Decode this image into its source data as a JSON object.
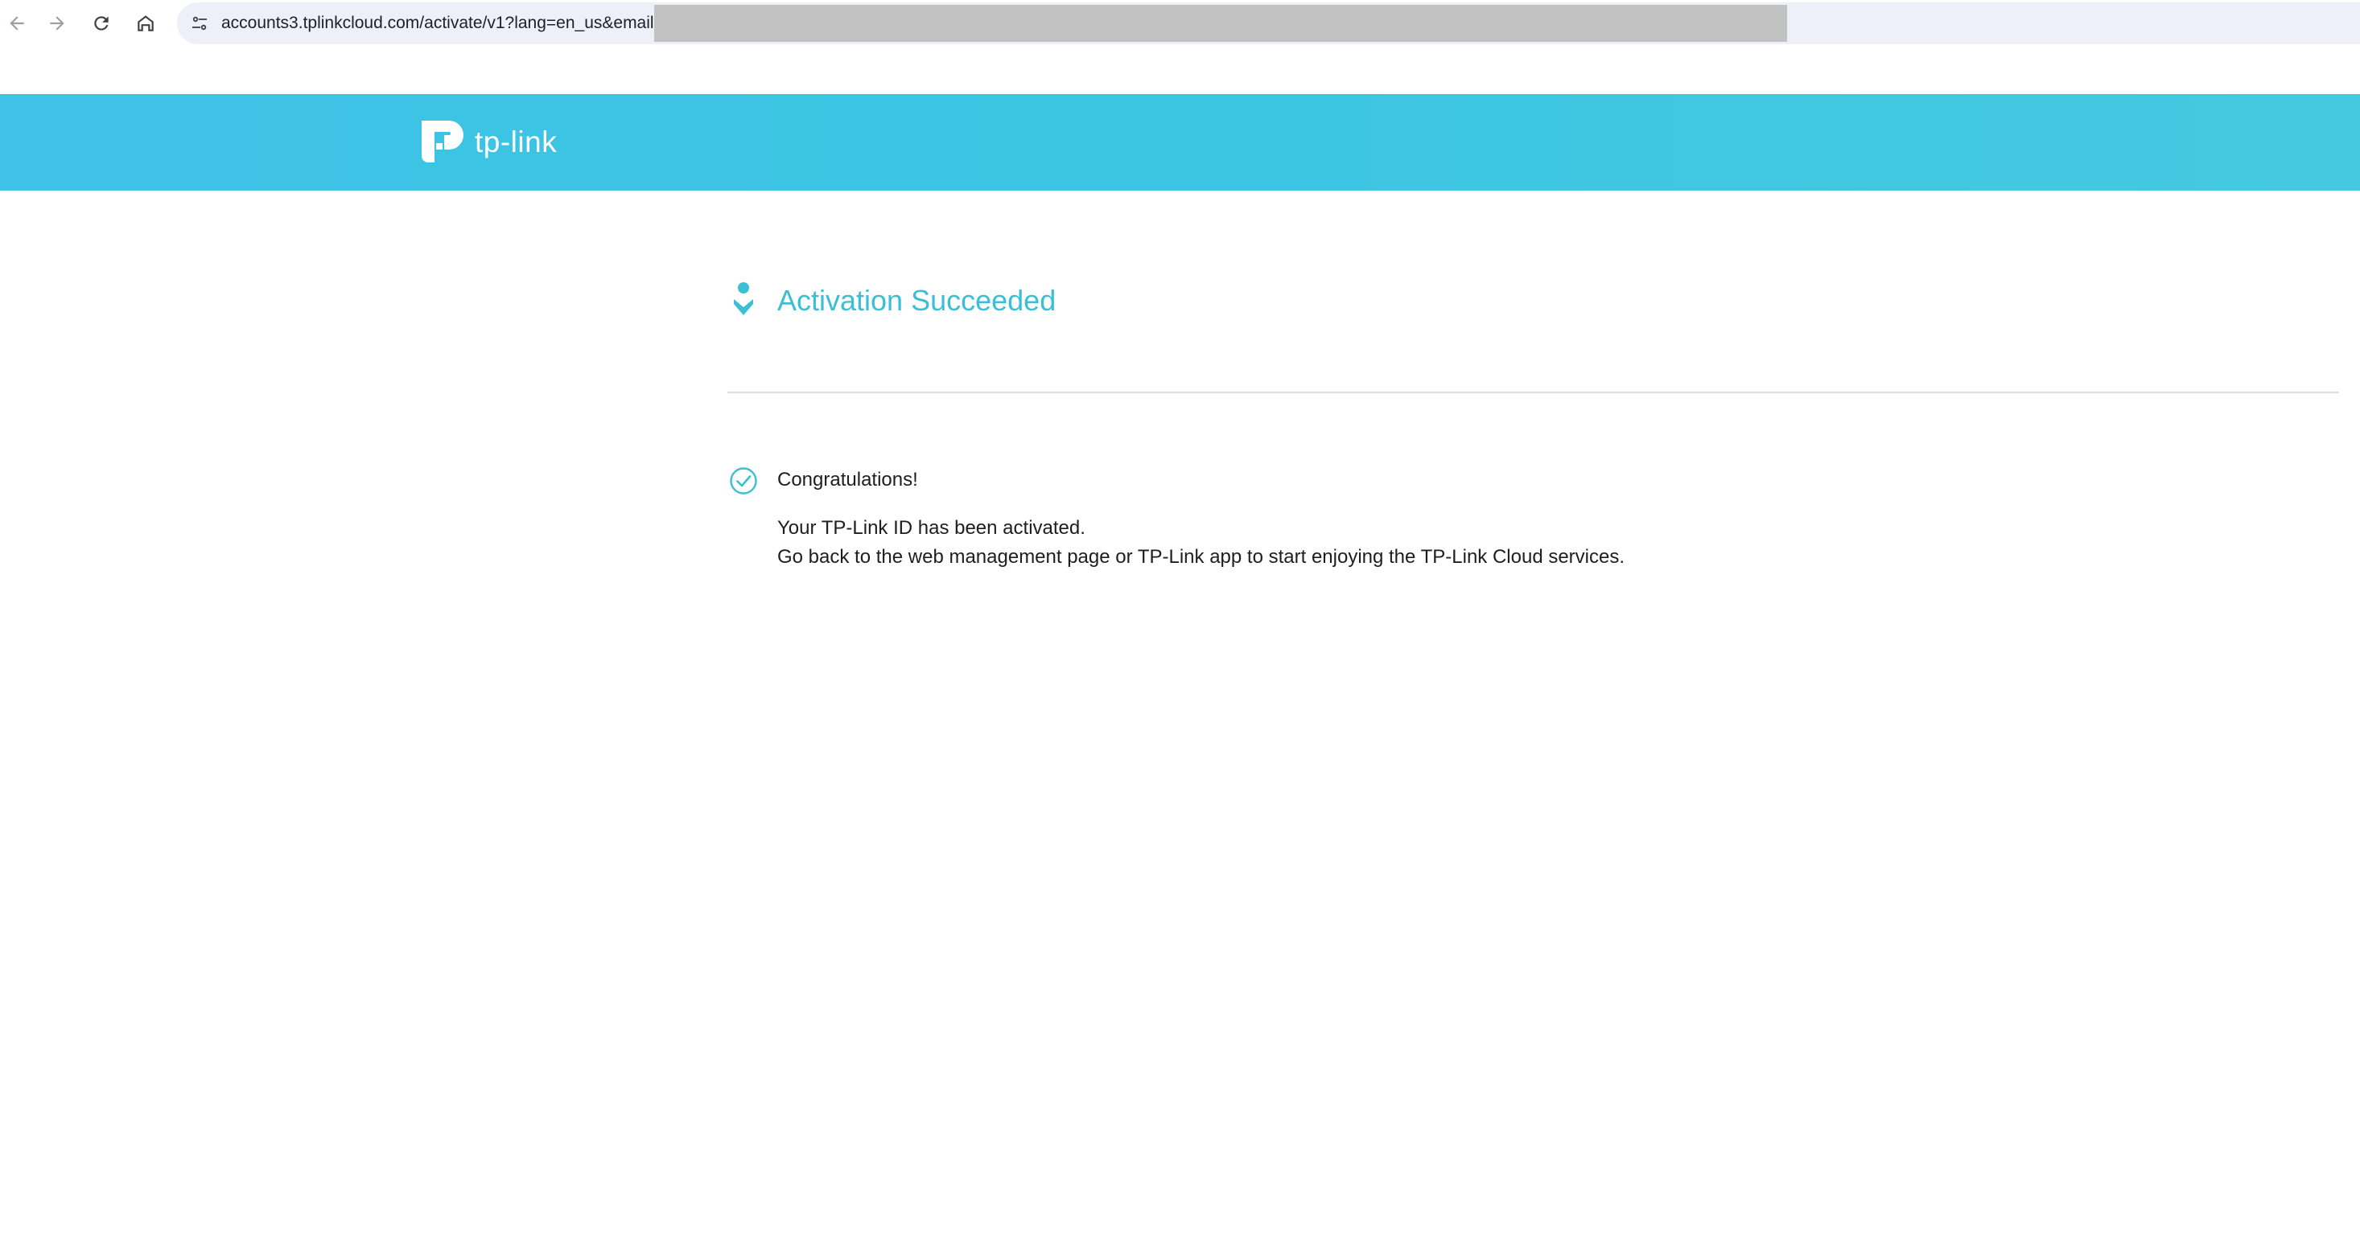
{
  "browser": {
    "url": "accounts3.tplinkcloud.com/activate/v1?lang=en_us&email",
    "icons": {
      "back": "arrow-left-icon",
      "forward": "arrow-right-icon",
      "reload": "reload-icon",
      "home": "home-icon",
      "site_info": "tune-icon"
    }
  },
  "brand": {
    "logo_text": "tp-link",
    "bar_color": "#3ec2e6"
  },
  "content": {
    "title": "Activation Succeeded",
    "title_color": "#3bbfd4",
    "congrats": "Congratulations!",
    "line1": "Your TP-Link ID has been activated.",
    "line2": "Go back to the web management page or TP-Link app to start enjoying the TP-Link Cloud services."
  }
}
